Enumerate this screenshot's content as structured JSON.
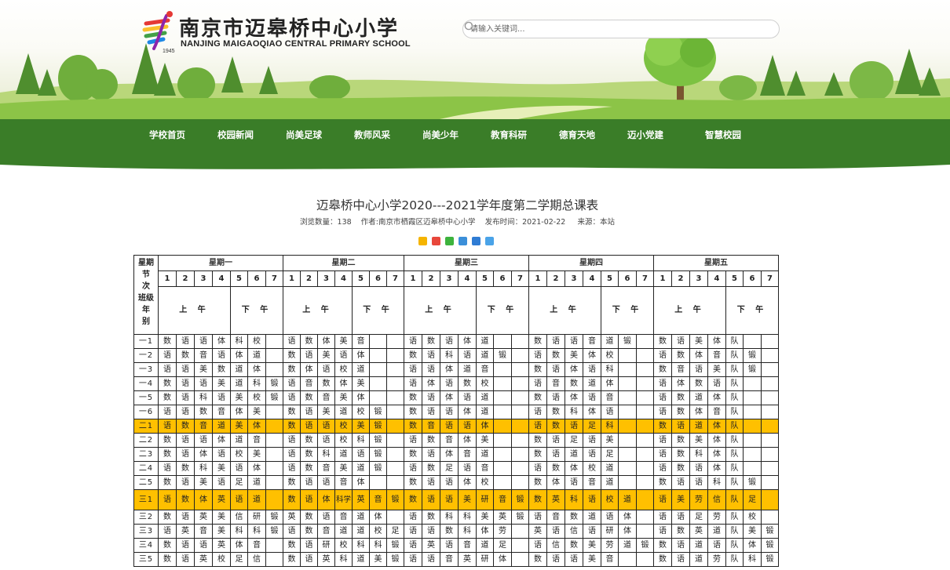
{
  "header": {
    "school_name_cn": "南京市迈皋桥中心小学",
    "school_name_en": "NANJING MAIGAOQIAO CENTRAL PRIMARY SCHOOL",
    "logo_year": "1945",
    "search_placeholder": "请输入关键词...",
    "search_icon": "search-icon"
  },
  "nav": {
    "items": [
      "学校首页",
      "校园新闻",
      "尚美足球",
      "教师风采",
      "尚美少年",
      "教育科研",
      "德育天地",
      "迈小党建",
      "智慧校园"
    ],
    "color": "#3a7d28"
  },
  "article": {
    "title": "迈皋桥中心小学2020---2021学年度第二学期总课表",
    "views_label": "浏览数量：",
    "views": "138",
    "author_label": "作者:",
    "author": "南京市栖霞区迈皋桥中心小学",
    "date_label": "发布时间：",
    "date": "2021-02-22",
    "source_label": "来源：",
    "source": "本站"
  },
  "share_icons": [
    "qzone-icon",
    "weibo-icon",
    "wechat-icon",
    "tencent-weibo-icon",
    "renren-icon",
    "more-share-icon"
  ],
  "timetable": {
    "corner_label": [
      "星期",
      "节",
      "次",
      "班级",
      "年",
      "别"
    ],
    "days": [
      "星期一",
      "星期二",
      "星期三",
      "星期四",
      "星期五"
    ],
    "periods": [
      "1",
      "2",
      "3",
      "4",
      "5",
      "6",
      "7"
    ],
    "am": "上 午",
    "pm": "下 午",
    "highlight_color": "#ffc000",
    "rows": [
      {
        "cls": "一1",
        "mon": [
          "数",
          "语",
          "语",
          "体",
          "科",
          "校",
          ""
        ],
        "tue": [
          "语",
          "数",
          "体",
          "美",
          "音",
          "",
          ""
        ],
        "wed": [
          "语",
          "数",
          "语",
          "体",
          "道",
          "",
          ""
        ],
        "thu": [
          "数",
          "语",
          "语",
          "音",
          "道",
          "锻",
          ""
        ],
        "fri": [
          "数",
          "语",
          "美",
          "体",
          "队",
          "",
          ""
        ]
      },
      {
        "cls": "一2",
        "mon": [
          "语",
          "数",
          "音",
          "语",
          "体",
          "道",
          ""
        ],
        "tue": [
          "数",
          "语",
          "美",
          "语",
          "体",
          "",
          ""
        ],
        "wed": [
          "数",
          "语",
          "科",
          "语",
          "道",
          "锻",
          ""
        ],
        "thu": [
          "语",
          "数",
          "美",
          "体",
          "校",
          "",
          ""
        ],
        "fri": [
          "语",
          "数",
          "体",
          "音",
          "队",
          "锻",
          ""
        ]
      },
      {
        "cls": "一3",
        "mon": [
          "语",
          "语",
          "美",
          "数",
          "道",
          "体",
          ""
        ],
        "tue": [
          "数",
          "体",
          "语",
          "校",
          "道",
          "",
          ""
        ],
        "wed": [
          "语",
          "语",
          "体",
          "道",
          "音",
          "",
          ""
        ],
        "thu": [
          "数",
          "语",
          "体",
          "语",
          "科",
          "",
          ""
        ],
        "fri": [
          "数",
          "音",
          "语",
          "美",
          "队",
          "锻",
          ""
        ]
      },
      {
        "cls": "一4",
        "mon": [
          "数",
          "语",
          "语",
          "美",
          "道",
          "科",
          "锻"
        ],
        "tue": [
          "语",
          "音",
          "数",
          "体",
          "美",
          "",
          ""
        ],
        "wed": [
          "语",
          "体",
          "语",
          "数",
          "校",
          "",
          ""
        ],
        "thu": [
          "语",
          "音",
          "数",
          "道",
          "体",
          "",
          ""
        ],
        "fri": [
          "语",
          "体",
          "数",
          "语",
          "队",
          "",
          ""
        ]
      },
      {
        "cls": "一5",
        "mon": [
          "数",
          "语",
          "科",
          "语",
          "美",
          "校",
          "锻"
        ],
        "tue": [
          "语",
          "数",
          "音",
          "美",
          "体",
          "",
          ""
        ],
        "wed": [
          "数",
          "语",
          "体",
          "语",
          "道",
          "",
          ""
        ],
        "thu": [
          "数",
          "语",
          "体",
          "语",
          "音",
          "",
          ""
        ],
        "fri": [
          "语",
          "数",
          "道",
          "体",
          "队",
          "",
          ""
        ]
      },
      {
        "cls": "一6",
        "mon": [
          "语",
          "语",
          "数",
          "音",
          "体",
          "美",
          ""
        ],
        "tue": [
          "数",
          "语",
          "美",
          "道",
          "校",
          "锻",
          ""
        ],
        "wed": [
          "数",
          "语",
          "语",
          "体",
          "道",
          "",
          ""
        ],
        "thu": [
          "语",
          "数",
          "科",
          "体",
          "语",
          "",
          ""
        ],
        "fri": [
          "语",
          "数",
          "体",
          "音",
          "队",
          "",
          ""
        ]
      },
      {
        "cls": "二1",
        "hl": true,
        "mon": [
          "语",
          "数",
          "音",
          "道",
          "美",
          "体",
          ""
        ],
        "tue": [
          "数",
          "语",
          "语",
          "校",
          "美",
          "锻",
          ""
        ],
        "wed": [
          "数",
          "音",
          "语",
          "语",
          "体",
          "",
          ""
        ],
        "thu": [
          "语",
          "数",
          "语",
          "足",
          "科",
          "",
          ""
        ],
        "fri": [
          "数",
          "语",
          "道",
          "体",
          "队",
          "",
          ""
        ]
      },
      {
        "cls": "二2",
        "mon": [
          "数",
          "语",
          "语",
          "体",
          "道",
          "音",
          ""
        ],
        "tue": [
          "语",
          "数",
          "语",
          "校",
          "科",
          "锻",
          ""
        ],
        "wed": [
          "语",
          "数",
          "音",
          "体",
          "美",
          "",
          ""
        ],
        "thu": [
          "数",
          "语",
          "足",
          "语",
          "美",
          "",
          ""
        ],
        "fri": [
          "语",
          "数",
          "美",
          "体",
          "队",
          "",
          ""
        ]
      },
      {
        "cls": "二3",
        "mon": [
          "数",
          "语",
          "体",
          "语",
          "校",
          "美",
          ""
        ],
        "tue": [
          "语",
          "数",
          "科",
          "道",
          "语",
          "锻",
          ""
        ],
        "wed": [
          "数",
          "语",
          "体",
          "音",
          "道",
          "",
          ""
        ],
        "thu": [
          "数",
          "语",
          "道",
          "语",
          "足",
          "",
          ""
        ],
        "fri": [
          "语",
          "数",
          "科",
          "体",
          "队",
          "",
          ""
        ]
      },
      {
        "cls": "二4",
        "mon": [
          "语",
          "数",
          "科",
          "美",
          "语",
          "体",
          ""
        ],
        "tue": [
          "语",
          "数",
          "音",
          "美",
          "道",
          "锻",
          ""
        ],
        "wed": [
          "语",
          "数",
          "足",
          "语",
          "音",
          "",
          ""
        ],
        "thu": [
          "语",
          "数",
          "体",
          "校",
          "道",
          "",
          ""
        ],
        "fri": [
          "语",
          "数",
          "语",
          "体",
          "队",
          "",
          ""
        ]
      },
      {
        "cls": "二5",
        "mon": [
          "数",
          "语",
          "美",
          "语",
          "足",
          "道",
          ""
        ],
        "tue": [
          "数",
          "语",
          "语",
          "音",
          "体",
          "",
          ""
        ],
        "wed": [
          "数",
          "语",
          "语",
          "体",
          "校",
          "",
          ""
        ],
        "thu": [
          "数",
          "体",
          "语",
          "音",
          "道",
          "",
          ""
        ],
        "fri": [
          "数",
          "语",
          "语",
          "科",
          "队",
          "锻",
          ""
        ]
      },
      {
        "cls": "三1",
        "hl": true,
        "tall": true,
        "mon": [
          "语",
          "数",
          "体",
          "英",
          "语",
          "道",
          ""
        ],
        "tue": [
          "数",
          "语",
          "体",
          "科学",
          "英",
          "音",
          "锻"
        ],
        "wed": [
          "数",
          "语",
          "语",
          "美",
          "研",
          "音",
          "锻"
        ],
        "thu": [
          "数",
          "英",
          "科",
          "语",
          "校",
          "道",
          ""
        ],
        "fri": [
          "语",
          "美",
          "劳",
          "信",
          "队",
          "足",
          ""
        ]
      },
      {
        "cls": "三2",
        "mon": [
          "数",
          "语",
          "英",
          "美",
          "信",
          "研",
          "锻"
        ],
        "tue": [
          "英",
          "数",
          "语",
          "音",
          "道",
          "体",
          ""
        ],
        "wed": [
          "语",
          "数",
          "科",
          "科",
          "美",
          "英",
          "锻"
        ],
        "thu": [
          "语",
          "音",
          "数",
          "道",
          "语",
          "体",
          ""
        ],
        "fri": [
          "语",
          "语",
          "足",
          "劳",
          "队",
          "校",
          ""
        ]
      },
      {
        "cls": "三3",
        "mon": [
          "语",
          "英",
          "音",
          "美",
          "科",
          "科",
          "锻"
        ],
        "tue": [
          "语",
          "数",
          "音",
          "道",
          "道",
          "校",
          "足"
        ],
        "wed": [
          "语",
          "语",
          "数",
          "科",
          "体",
          "劳",
          ""
        ],
        "thu": [
          "英",
          "语",
          "信",
          "语",
          "研",
          "体",
          ""
        ],
        "fri": [
          "语",
          "数",
          "英",
          "道",
          "队",
          "美",
          "锻"
        ]
      },
      {
        "cls": "三4",
        "mon": [
          "数",
          "语",
          "语",
          "英",
          "体",
          "音",
          ""
        ],
        "tue": [
          "数",
          "语",
          "研",
          "校",
          "科",
          "科",
          "锻"
        ],
        "wed": [
          "语",
          "英",
          "语",
          "音",
          "道",
          "足",
          ""
        ],
        "thu": [
          "语",
          "信",
          "数",
          "美",
          "劳",
          "道",
          "锻"
        ],
        "fri": [
          "数",
          "语",
          "道",
          "语",
          "队",
          "体",
          "锻"
        ]
      },
      {
        "cls": "三5",
        "mon": [
          "数",
          "语",
          "英",
          "校",
          "足",
          "信",
          ""
        ],
        "tue": [
          "数",
          "语",
          "英",
          "科",
          "道",
          "美",
          "锻"
        ],
        "wed": [
          "语",
          "语",
          "音",
          "英",
          "研",
          "体",
          ""
        ],
        "thu": [
          "数",
          "语",
          "语",
          "美",
          "音",
          "",
          ""
        ],
        "fri": [
          "数",
          "语",
          "道",
          "劳",
          "队",
          "科",
          "锻"
        ]
      }
    ]
  }
}
